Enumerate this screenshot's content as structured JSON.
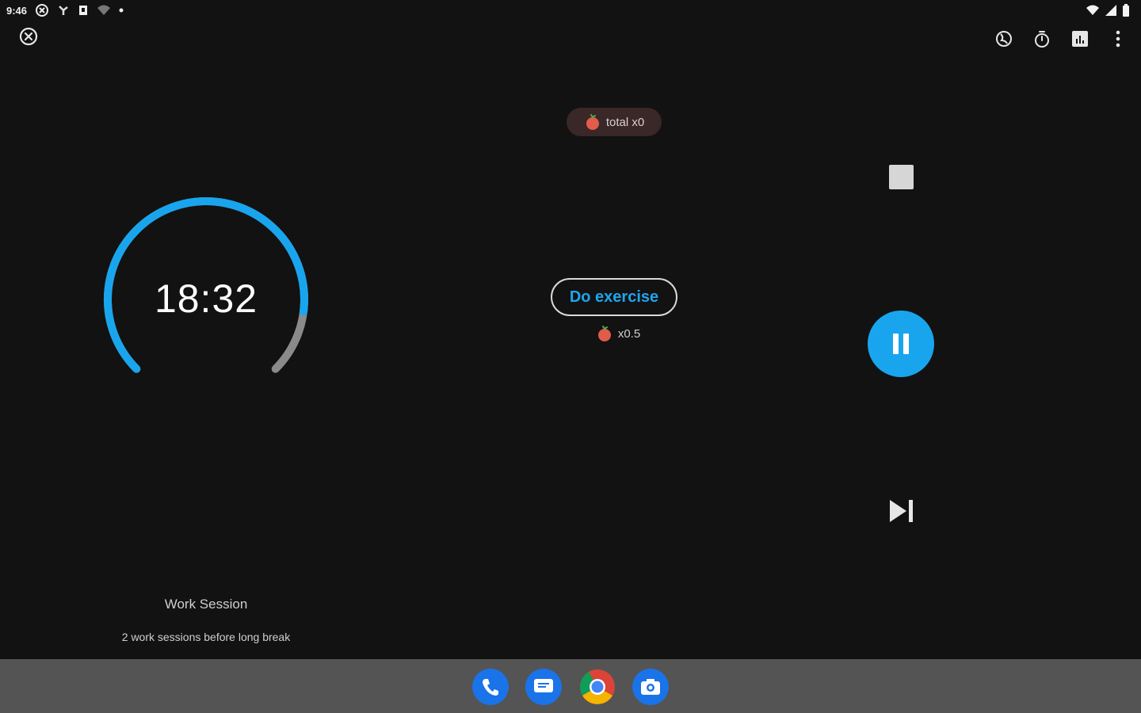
{
  "status_bar": {
    "time": "9:46"
  },
  "timer": {
    "display": "18:32",
    "progress_remaining_fraction": 0.86,
    "accent_color": "#19a5ee",
    "track_color": "#8a8a8a"
  },
  "total": {
    "label": "total x0"
  },
  "exercise": {
    "button_label": "Do exercise",
    "multiplier": "x0.5"
  },
  "session": {
    "title": "Work Session",
    "subtitle": "2 work sessions before long break"
  },
  "icons": {
    "close": "close-circle-icon",
    "top_actions": [
      "focus-icon",
      "stopwatch-icon",
      "stats-icon",
      "more-vert-icon"
    ],
    "dock": [
      "phone-icon",
      "messages-icon",
      "chrome-icon",
      "camera-icon"
    ]
  }
}
